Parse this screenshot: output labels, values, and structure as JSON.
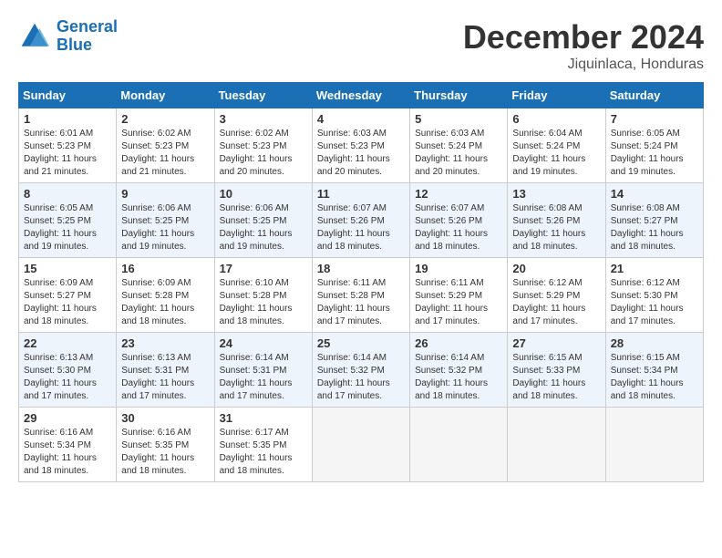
{
  "header": {
    "logo_line1": "General",
    "logo_line2": "Blue",
    "month_title": "December 2024",
    "location": "Jiquinlaca, Honduras"
  },
  "days_of_week": [
    "Sunday",
    "Monday",
    "Tuesday",
    "Wednesday",
    "Thursday",
    "Friday",
    "Saturday"
  ],
  "weeks": [
    [
      {
        "day": "1",
        "lines": [
          "Sunrise: 6:01 AM",
          "Sunset: 5:23 PM",
          "Daylight: 11 hours",
          "and 21 minutes."
        ]
      },
      {
        "day": "2",
        "lines": [
          "Sunrise: 6:02 AM",
          "Sunset: 5:23 PM",
          "Daylight: 11 hours",
          "and 21 minutes."
        ]
      },
      {
        "day": "3",
        "lines": [
          "Sunrise: 6:02 AM",
          "Sunset: 5:23 PM",
          "Daylight: 11 hours",
          "and 20 minutes."
        ]
      },
      {
        "day": "4",
        "lines": [
          "Sunrise: 6:03 AM",
          "Sunset: 5:23 PM",
          "Daylight: 11 hours",
          "and 20 minutes."
        ]
      },
      {
        "day": "5",
        "lines": [
          "Sunrise: 6:03 AM",
          "Sunset: 5:24 PM",
          "Daylight: 11 hours",
          "and 20 minutes."
        ]
      },
      {
        "day": "6",
        "lines": [
          "Sunrise: 6:04 AM",
          "Sunset: 5:24 PM",
          "Daylight: 11 hours",
          "and 19 minutes."
        ]
      },
      {
        "day": "7",
        "lines": [
          "Sunrise: 6:05 AM",
          "Sunset: 5:24 PM",
          "Daylight: 11 hours",
          "and 19 minutes."
        ]
      }
    ],
    [
      {
        "day": "8",
        "lines": [
          "Sunrise: 6:05 AM",
          "Sunset: 5:25 PM",
          "Daylight: 11 hours",
          "and 19 minutes."
        ]
      },
      {
        "day": "9",
        "lines": [
          "Sunrise: 6:06 AM",
          "Sunset: 5:25 PM",
          "Daylight: 11 hours",
          "and 19 minutes."
        ]
      },
      {
        "day": "10",
        "lines": [
          "Sunrise: 6:06 AM",
          "Sunset: 5:25 PM",
          "Daylight: 11 hours",
          "and 19 minutes."
        ]
      },
      {
        "day": "11",
        "lines": [
          "Sunrise: 6:07 AM",
          "Sunset: 5:26 PM",
          "Daylight: 11 hours",
          "and 18 minutes."
        ]
      },
      {
        "day": "12",
        "lines": [
          "Sunrise: 6:07 AM",
          "Sunset: 5:26 PM",
          "Daylight: 11 hours",
          "and 18 minutes."
        ]
      },
      {
        "day": "13",
        "lines": [
          "Sunrise: 6:08 AM",
          "Sunset: 5:26 PM",
          "Daylight: 11 hours",
          "and 18 minutes."
        ]
      },
      {
        "day": "14",
        "lines": [
          "Sunrise: 6:08 AM",
          "Sunset: 5:27 PM",
          "Daylight: 11 hours",
          "and 18 minutes."
        ]
      }
    ],
    [
      {
        "day": "15",
        "lines": [
          "Sunrise: 6:09 AM",
          "Sunset: 5:27 PM",
          "Daylight: 11 hours",
          "and 18 minutes."
        ]
      },
      {
        "day": "16",
        "lines": [
          "Sunrise: 6:09 AM",
          "Sunset: 5:28 PM",
          "Daylight: 11 hours",
          "and 18 minutes."
        ]
      },
      {
        "day": "17",
        "lines": [
          "Sunrise: 6:10 AM",
          "Sunset: 5:28 PM",
          "Daylight: 11 hours",
          "and 18 minutes."
        ]
      },
      {
        "day": "18",
        "lines": [
          "Sunrise: 6:11 AM",
          "Sunset: 5:28 PM",
          "Daylight: 11 hours",
          "and 17 minutes."
        ]
      },
      {
        "day": "19",
        "lines": [
          "Sunrise: 6:11 AM",
          "Sunset: 5:29 PM",
          "Daylight: 11 hours",
          "and 17 minutes."
        ]
      },
      {
        "day": "20",
        "lines": [
          "Sunrise: 6:12 AM",
          "Sunset: 5:29 PM",
          "Daylight: 11 hours",
          "and 17 minutes."
        ]
      },
      {
        "day": "21",
        "lines": [
          "Sunrise: 6:12 AM",
          "Sunset: 5:30 PM",
          "Daylight: 11 hours",
          "and 17 minutes."
        ]
      }
    ],
    [
      {
        "day": "22",
        "lines": [
          "Sunrise: 6:13 AM",
          "Sunset: 5:30 PM",
          "Daylight: 11 hours",
          "and 17 minutes."
        ]
      },
      {
        "day": "23",
        "lines": [
          "Sunrise: 6:13 AM",
          "Sunset: 5:31 PM",
          "Daylight: 11 hours",
          "and 17 minutes."
        ]
      },
      {
        "day": "24",
        "lines": [
          "Sunrise: 6:14 AM",
          "Sunset: 5:31 PM",
          "Daylight: 11 hours",
          "and 17 minutes."
        ]
      },
      {
        "day": "25",
        "lines": [
          "Sunrise: 6:14 AM",
          "Sunset: 5:32 PM",
          "Daylight: 11 hours",
          "and 17 minutes."
        ]
      },
      {
        "day": "26",
        "lines": [
          "Sunrise: 6:14 AM",
          "Sunset: 5:32 PM",
          "Daylight: 11 hours",
          "and 18 minutes."
        ]
      },
      {
        "day": "27",
        "lines": [
          "Sunrise: 6:15 AM",
          "Sunset: 5:33 PM",
          "Daylight: 11 hours",
          "and 18 minutes."
        ]
      },
      {
        "day": "28",
        "lines": [
          "Sunrise: 6:15 AM",
          "Sunset: 5:34 PM",
          "Daylight: 11 hours",
          "and 18 minutes."
        ]
      }
    ],
    [
      {
        "day": "29",
        "lines": [
          "Sunrise: 6:16 AM",
          "Sunset: 5:34 PM",
          "Daylight: 11 hours",
          "and 18 minutes."
        ]
      },
      {
        "day": "30",
        "lines": [
          "Sunrise: 6:16 AM",
          "Sunset: 5:35 PM",
          "Daylight: 11 hours",
          "and 18 minutes."
        ]
      },
      {
        "day": "31",
        "lines": [
          "Sunrise: 6:17 AM",
          "Sunset: 5:35 PM",
          "Daylight: 11 hours",
          "and 18 minutes."
        ]
      },
      null,
      null,
      null,
      null
    ]
  ]
}
